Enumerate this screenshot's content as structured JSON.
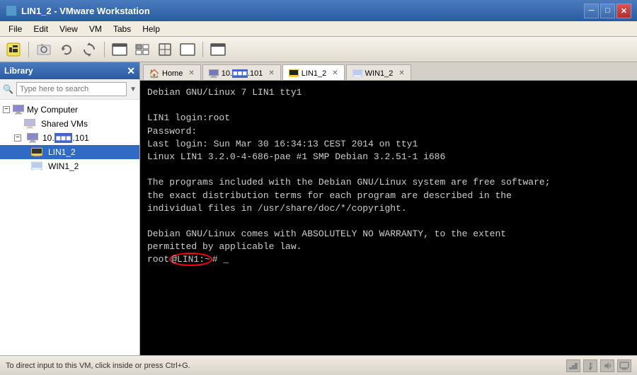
{
  "titlebar": {
    "title": "LIN1_2 - VMware Workstation",
    "icon": "vmware-icon"
  },
  "menubar": {
    "items": [
      "File",
      "Edit",
      "View",
      "VM",
      "Tabs",
      "Help"
    ]
  },
  "toolbar": {
    "buttons": [
      {
        "name": "vm-power-button",
        "icon": "⚡"
      },
      {
        "name": "separator"
      },
      {
        "name": "snapshot-button",
        "icon": "📷"
      },
      {
        "name": "revert-button",
        "icon": "↩"
      },
      {
        "name": "refresh-button",
        "icon": "🔄"
      },
      {
        "name": "separator"
      },
      {
        "name": "fullscreen-button",
        "icon": "⬜"
      },
      {
        "name": "unity-button",
        "icon": "⊞"
      },
      {
        "name": "clone-button",
        "icon": "⬛"
      },
      {
        "name": "separator"
      },
      {
        "name": "display-button",
        "icon": "📺"
      }
    ]
  },
  "sidebar": {
    "title": "Library",
    "search_placeholder": "Type here to search",
    "tree": [
      {
        "id": "my-computer",
        "label": "My Computer",
        "level": 0,
        "icon": "computer",
        "expandable": true
      },
      {
        "id": "shared-vms",
        "label": "Shared VMs",
        "level": 1,
        "icon": "folder",
        "expandable": false
      },
      {
        "id": "host-10",
        "label": "10.■■■.101",
        "level": 1,
        "icon": "computer",
        "expandable": true
      },
      {
        "id": "lin1-2",
        "label": "LIN1_2",
        "level": 2,
        "icon": "vm-linux",
        "expandable": false,
        "selected": true
      },
      {
        "id": "win1-2",
        "label": "WIN1_2",
        "level": 2,
        "icon": "vm-windows",
        "expandable": false
      }
    ]
  },
  "tabs": [
    {
      "id": "home",
      "label": "Home",
      "icon": "home",
      "active": false,
      "closable": true
    },
    {
      "id": "remote-host",
      "label": "10.■■■.101",
      "icon": "computer",
      "active": false,
      "closable": true
    },
    {
      "id": "lin1-2",
      "label": "LIN1_2",
      "icon": "vm-linux",
      "active": true,
      "closable": true
    },
    {
      "id": "win1-2",
      "label": "WIN1_2",
      "icon": "vm-windows",
      "active": false,
      "closable": true
    }
  ],
  "terminal": {
    "content": "Debian GNU/Linux 7 LIN1 tty1\n\nLIN1 login:root\nPassword:\nLast login: Sun Mar 30 16:34:13 CEST 2014 on tty1\nLinux LIN1 3.2.0-4-686-pae #1 SMP Debian 3.2.51-1 i686\n\nThe programs included with the Debian GNU/Linux system are free software;\nthe exact distribution terms for each program are described in the\nindividual files in /usr/share/doc/*/copyright.\n\nDebian GNU/Linux comes with ABSOLUTELY NO WARRANTY, to the extent\npermitted by applicable law.",
    "prompt_before": "root",
    "prompt_highlight": "@LIN1:",
    "prompt_after": "~# _"
  },
  "statusbar": {
    "text": "To direct input to this VM, click inside or press Ctrl+G.",
    "icons": [
      "network-icon",
      "usb-icon",
      "audio-icon",
      "display-icon"
    ]
  }
}
